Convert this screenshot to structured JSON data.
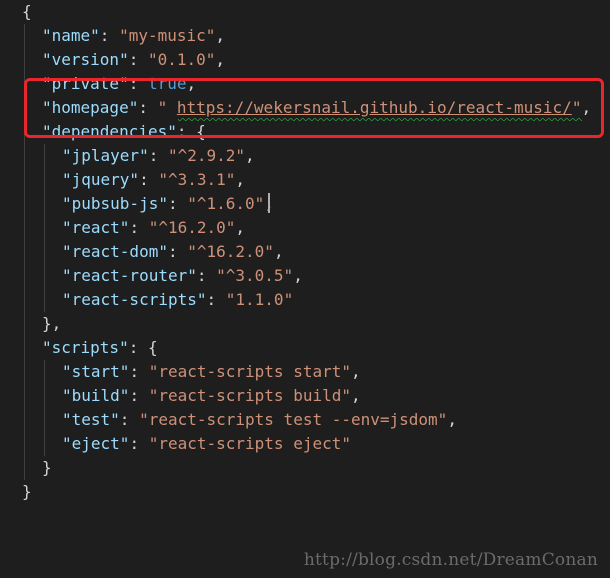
{
  "editor": {
    "lines": [
      {
        "indent": 0,
        "tokens": [
          {
            "t": "p",
            "v": "{"
          }
        ]
      },
      {
        "indent": 1,
        "tokens": [
          {
            "t": "k",
            "v": "\"name\""
          },
          {
            "t": "p",
            "v": ": "
          },
          {
            "t": "s",
            "v": "\"my-music\""
          },
          {
            "t": "p",
            "v": ","
          }
        ]
      },
      {
        "indent": 1,
        "tokens": [
          {
            "t": "k",
            "v": "\"version\""
          },
          {
            "t": "p",
            "v": ": "
          },
          {
            "t": "s",
            "v": "\"0.1.0\""
          },
          {
            "t": "p",
            "v": ","
          }
        ]
      },
      {
        "indent": 1,
        "tokens": [
          {
            "t": "k",
            "v": "\"private\""
          },
          {
            "t": "p",
            "v": ": "
          },
          {
            "t": "kw",
            "v": "true"
          },
          {
            "t": "p",
            "v": ","
          }
        ]
      },
      {
        "indent": 1,
        "tokens": [
          {
            "t": "k",
            "v": "\"homepage\""
          },
          {
            "t": "p",
            "v": ": "
          },
          {
            "t": "s",
            "v": "\" "
          },
          {
            "t": "url",
            "v": "https://wekersnail.github.io/react-music/"
          },
          {
            "t": "s",
            "v": "\""
          },
          {
            "t": "p",
            "v": ","
          }
        ]
      },
      {
        "indent": 1,
        "tokens": [
          {
            "t": "k",
            "v": "\"dependencies\""
          },
          {
            "t": "p",
            "v": ": {"
          }
        ]
      },
      {
        "indent": 2,
        "tokens": [
          {
            "t": "k",
            "v": "\"jplayer\""
          },
          {
            "t": "p",
            "v": ": "
          },
          {
            "t": "s",
            "v": "\"^2.9.2\""
          },
          {
            "t": "p",
            "v": ","
          }
        ]
      },
      {
        "indent": 2,
        "tokens": [
          {
            "t": "k",
            "v": "\"jquery\""
          },
          {
            "t": "p",
            "v": ": "
          },
          {
            "t": "s",
            "v": "\"^3.3.1\""
          },
          {
            "t": "p",
            "v": ","
          }
        ]
      },
      {
        "indent": 2,
        "tokens": [
          {
            "t": "k",
            "v": "\"pubsub-js\""
          },
          {
            "t": "p",
            "v": ": "
          },
          {
            "t": "s",
            "v": "\"^1.6.0\""
          },
          {
            "t": "p",
            "v": ","
          }
        ]
      },
      {
        "indent": 2,
        "tokens": [
          {
            "t": "k",
            "v": "\"react\""
          },
          {
            "t": "p",
            "v": ": "
          },
          {
            "t": "s",
            "v": "\"^16.2.0\""
          },
          {
            "t": "p",
            "v": ","
          }
        ]
      },
      {
        "indent": 2,
        "tokens": [
          {
            "t": "k",
            "v": "\"react-dom\""
          },
          {
            "t": "p",
            "v": ": "
          },
          {
            "t": "s",
            "v": "\"^16.2.0\""
          },
          {
            "t": "p",
            "v": ","
          }
        ]
      },
      {
        "indent": 2,
        "tokens": [
          {
            "t": "k",
            "v": "\"react-router\""
          },
          {
            "t": "p",
            "v": ": "
          },
          {
            "t": "s",
            "v": "\"^3.0.5\""
          },
          {
            "t": "p",
            "v": ","
          }
        ]
      },
      {
        "indent": 2,
        "tokens": [
          {
            "t": "k",
            "v": "\"react-scripts\""
          },
          {
            "t": "p",
            "v": ": "
          },
          {
            "t": "s",
            "v": "\"1.1.0\""
          }
        ]
      },
      {
        "indent": 1,
        "tokens": [
          {
            "t": "p",
            "v": "},"
          }
        ]
      },
      {
        "indent": 1,
        "tokens": [
          {
            "t": "k",
            "v": "\"scripts\""
          },
          {
            "t": "p",
            "v": ": {"
          }
        ]
      },
      {
        "indent": 2,
        "tokens": [
          {
            "t": "k",
            "v": "\"start\""
          },
          {
            "t": "p",
            "v": ": "
          },
          {
            "t": "s",
            "v": "\"react-scripts start\""
          },
          {
            "t": "p",
            "v": ","
          }
        ]
      },
      {
        "indent": 2,
        "tokens": [
          {
            "t": "k",
            "v": "\"build\""
          },
          {
            "t": "p",
            "v": ": "
          },
          {
            "t": "s",
            "v": "\"react-scripts build\""
          },
          {
            "t": "p",
            "v": ","
          }
        ]
      },
      {
        "indent": 2,
        "tokens": [
          {
            "t": "k",
            "v": "\"test\""
          },
          {
            "t": "p",
            "v": ": "
          },
          {
            "t": "s",
            "v": "\"react-scripts test --env=jsdom\""
          },
          {
            "t": "p",
            "v": ","
          }
        ]
      },
      {
        "indent": 2,
        "tokens": [
          {
            "t": "k",
            "v": "\"eject\""
          },
          {
            "t": "p",
            "v": ": "
          },
          {
            "t": "s",
            "v": "\"react-scripts eject\""
          }
        ]
      },
      {
        "indent": 1,
        "tokens": [
          {
            "t": "p",
            "v": "}"
          }
        ]
      },
      {
        "indent": 0,
        "tokens": [
          {
            "t": "p",
            "v": "}"
          }
        ]
      }
    ]
  },
  "watermark": "http://blog.csdn.net/DreamConan",
  "colors": {
    "background": "#1e1e1e",
    "key": "#9cdcfe",
    "string": "#ce9178",
    "keyword": "#569cd6",
    "punctuation": "#d4d4d4",
    "highlight_box": "#e8262b",
    "squiggle": "#2ea043"
  }
}
